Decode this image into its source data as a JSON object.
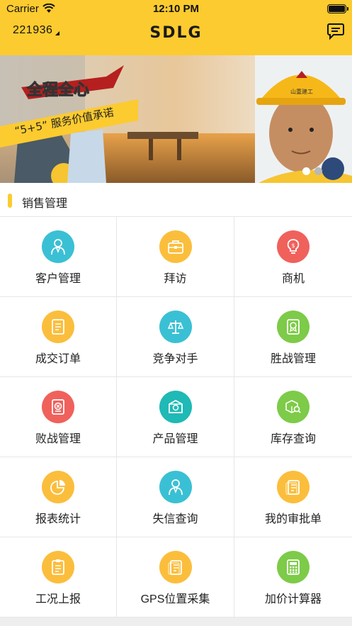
{
  "status_bar": {
    "carrier": "Carrier",
    "time": "12:10 PM"
  },
  "header": {
    "user_id": "221936",
    "logo": "SDLG"
  },
  "banner": {
    "badge_text": "全程全心",
    "slogan_text": "“5+5” 服务价值承诺",
    "helmet_text": "山重建工"
  },
  "section": {
    "title": "销售管理"
  },
  "grid": [
    {
      "label": "客户管理",
      "icon": "person-icon",
      "color": "#3AC0D4"
    },
    {
      "label": "拜访",
      "icon": "briefcase-icon",
      "color": "#FBBE3C"
    },
    {
      "label": "商机",
      "icon": "lightbulb-icon",
      "color": "#F0615C"
    },
    {
      "label": "成交订单",
      "icon": "document-icon",
      "color": "#FBBE3C"
    },
    {
      "label": "竞争对手",
      "icon": "scale-icon",
      "color": "#3AC0D4"
    },
    {
      "label": "胜战管理",
      "icon": "award-icon",
      "color": "#7DCB48"
    },
    {
      "label": "败战管理",
      "icon": "cross-document-icon",
      "color": "#F0615C"
    },
    {
      "label": "产品管理",
      "icon": "box-icon",
      "color": "#1FB9B6"
    },
    {
      "label": "库存查询",
      "icon": "package-search-icon",
      "color": "#7DCB48"
    },
    {
      "label": "报表统计",
      "icon": "pie-chart-icon",
      "color": "#FBBE3C"
    },
    {
      "label": "失信查询",
      "icon": "person-icon",
      "color": "#3AC0D4"
    },
    {
      "label": "我的审批单",
      "icon": "approval-icon",
      "color": "#FBBE3C"
    },
    {
      "label": "工况上报",
      "icon": "report-icon",
      "color": "#FBBE3C"
    },
    {
      "label": "GPS位置采集",
      "icon": "approval-icon",
      "color": "#FBBE3C"
    },
    {
      "label": "加价计算器",
      "icon": "calculator-icon",
      "color": "#7DCB48"
    }
  ],
  "colors": {
    "brand": "#FCCB2F",
    "divider": "#E6E6E6"
  }
}
